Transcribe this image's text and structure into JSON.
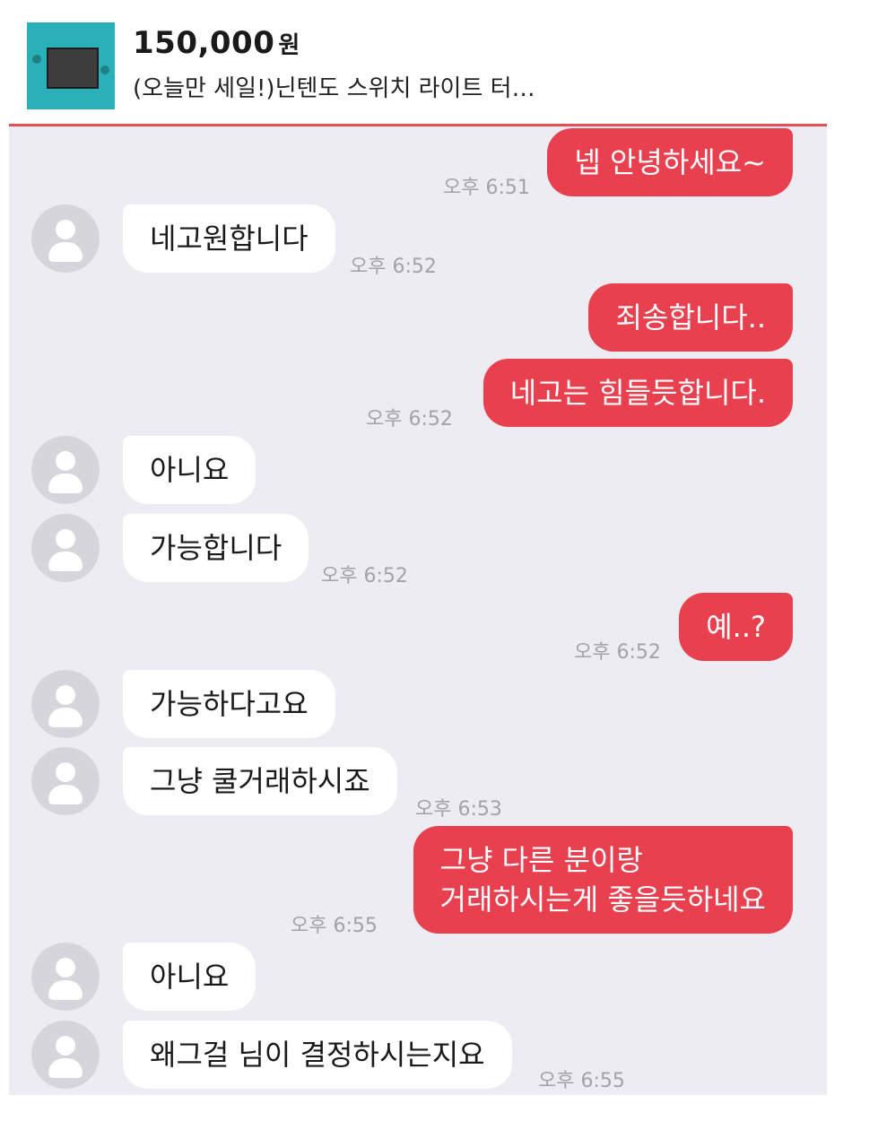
{
  "listing": {
    "thumbnail_icon": "nintendo-switch-lite-thumbnail",
    "price": "150,000",
    "currency": "원",
    "title": "(오늘만 세일!)닌텐도 스위치 라이트 터…"
  },
  "theme": {
    "accent": "#e9404f",
    "chat_background": "#edecf2"
  },
  "messages": [
    {
      "from": "me",
      "text": "넵 안녕하세요~",
      "time": "오후 6:51"
    },
    {
      "from": "them",
      "text": "네고원합니다",
      "time": "오후 6:52"
    },
    {
      "from": "me",
      "text": "죄송합니다..",
      "time": ""
    },
    {
      "from": "me",
      "text": "네고는 힘들듯합니다.",
      "time": "오후 6:52"
    },
    {
      "from": "them",
      "text": "아니요",
      "time": ""
    },
    {
      "from": "them",
      "text": "가능합니다",
      "time": "오후 6:52"
    },
    {
      "from": "me",
      "text": "예..?",
      "time": "오후 6:52"
    },
    {
      "from": "them",
      "text": "가능하다고요",
      "time": ""
    },
    {
      "from": "them",
      "text": "그냥 쿨거래하시죠",
      "time": "오후 6:53"
    },
    {
      "from": "me",
      "text_lines": [
        "그냥 다른 분이랑",
        "거래하시는게 좋을듯하네요"
      ],
      "time": "오후 6:55"
    },
    {
      "from": "them",
      "text": "아니요",
      "time": ""
    },
    {
      "from": "them",
      "text": "왜그걸 님이 결정하시는지요",
      "time": "오후 6:55"
    }
  ]
}
